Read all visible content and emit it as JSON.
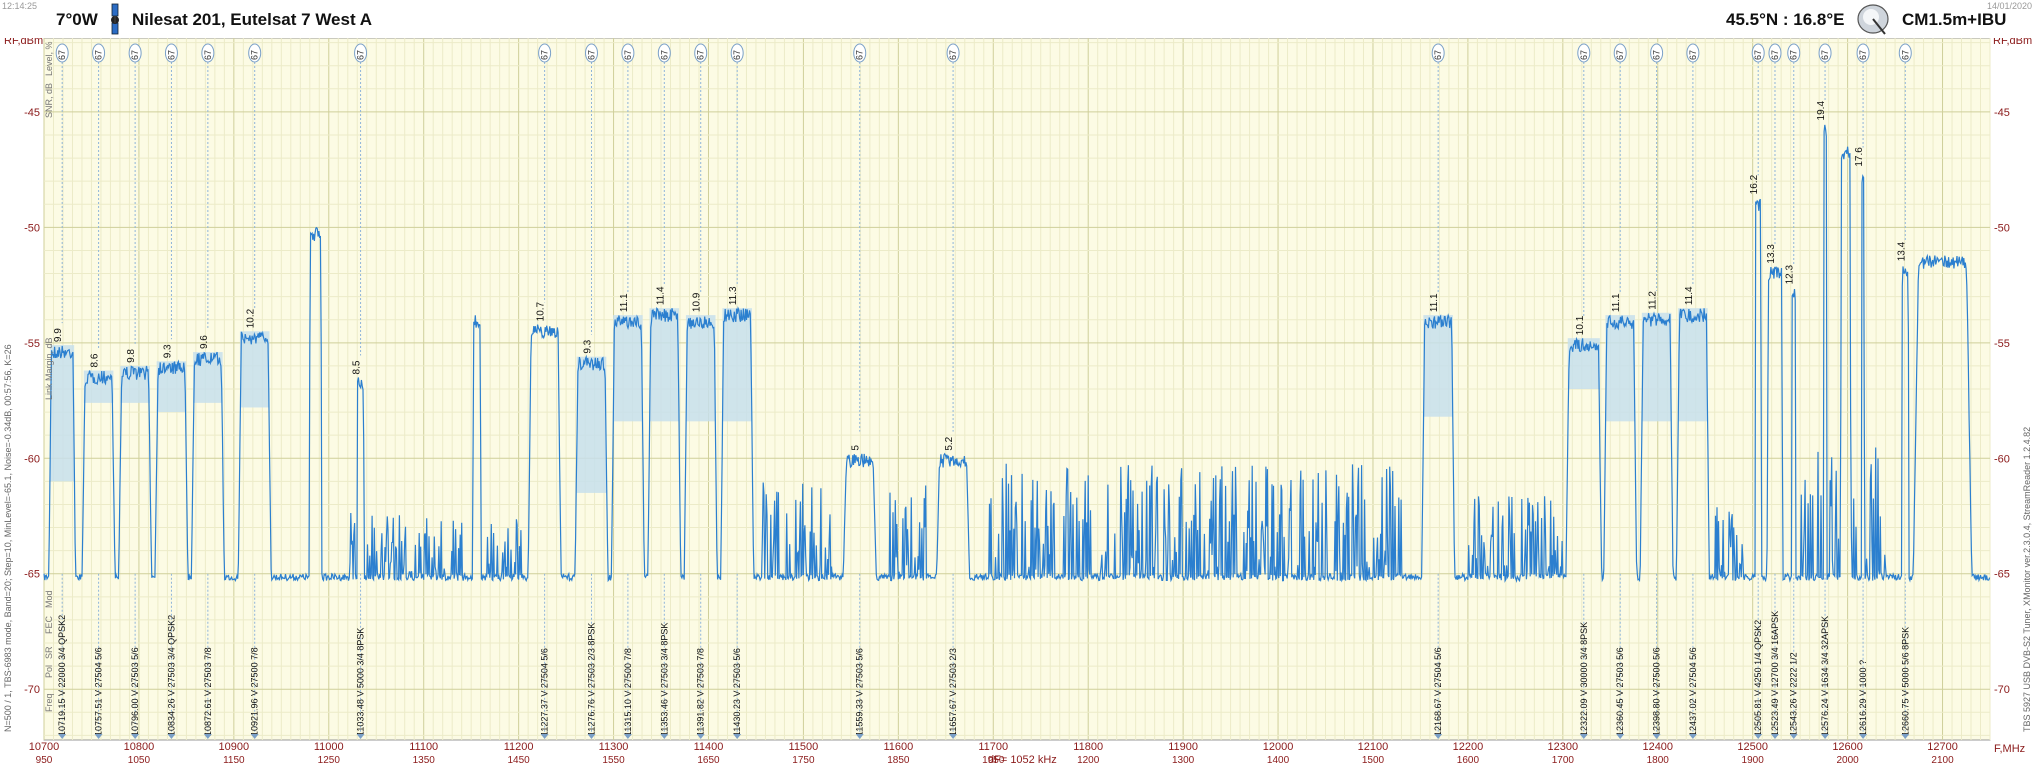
{
  "header": {
    "time": "12:14:25",
    "date": "14/01/2020",
    "orbital_position": "7°0W",
    "satellite_name": "Nilesat 201, Eutelsat 7 West A",
    "location": "45.5°N : 16.8°E",
    "antenna": "CM1.5m+IBU"
  },
  "labels": {
    "left_axis_unit": "RF,dBm",
    "right_axis_unit": "RF,dBm",
    "x_axis_unit": "F,MHz",
    "df_label": "dF= 1052 kHz",
    "left_side_text": "N=500 / 1, TBS-6983 mode, Band=20; Step=10, MinLevel=-65.1, Noise=-0.34dB, 00:57:56, K=26",
    "right_side_text": "TBS 5927 USB DVB-S2 Tuner, XMonitor ver.2.3.0.4, StreamReader 1.2.4.82",
    "vertical_header_top": "Level, %",
    "vertical_header_snr": "SNR, dB",
    "vertical_header_margin": "Link Margin, dB",
    "vertical_header_freq": "Freq",
    "vertical_header_pol": "Pol",
    "vertical_header_sr": "SR",
    "vertical_header_fec": "FEC",
    "vertical_header_mod": "Mod",
    "level_badge": "67"
  },
  "colors": {
    "plot_bg": "#fcfbe4",
    "grid": "#d8d8a8",
    "trace": "#2b7fcf",
    "fill": "#c7dfec",
    "axis_label": "#8b1a1a",
    "text": "#111111"
  },
  "chart_data": {
    "type": "line",
    "title": "",
    "xlabel": "F,MHz",
    "ylabel": "RF,dBm",
    "xlim": [
      10700,
      12750
    ],
    "ylim": [
      -72.2,
      -41.8
    ],
    "x_ticks": [
      10700,
      10800,
      10900,
      11000,
      11100,
      11200,
      11300,
      11400,
      11500,
      11600,
      11700,
      11800,
      11900,
      12000,
      12100,
      12200,
      12300,
      12400,
      12500,
      12600,
      12700
    ],
    "if_ticks": [
      950,
      1050,
      1150,
      1250,
      1350,
      1450,
      1550,
      1650,
      1750,
      1850,
      1950,
      1200,
      1300,
      1400,
      1500,
      1600,
      1700,
      1800,
      1900,
      2000,
      2100
    ],
    "y_ticks": [
      -45,
      -50,
      -55,
      -60,
      -65,
      -70
    ],
    "grid": true,
    "noise_floor": -65,
    "carriers": [
      {
        "freq": "10719.15",
        "pol": "V",
        "sr": "22000",
        "fec": "3/4",
        "mod": "QPSK2",
        "snr": "9.9",
        "f": 10719.15,
        "w": 22.0,
        "level": -55.1,
        "fill_top": -61.0
      },
      {
        "freq": "10757.51",
        "pol": "V",
        "sr": "27504",
        "fec": "5/6",
        "mod": "",
        "snr": "8.6",
        "f": 10757.51,
        "w": 27.5,
        "level": -56.2,
        "fill_top": -57.6
      },
      {
        "freq": "10796.00",
        "pol": "V",
        "sr": "27503",
        "fec": "5/6",
        "mod": "",
        "snr": "9.8",
        "f": 10796.0,
        "w": 27.5,
        "level": -56.0,
        "fill_top": -57.6
      },
      {
        "freq": "10834.26",
        "pol": "V",
        "sr": "27503",
        "fec": "3/4",
        "mod": "QPSK2",
        "snr": "9.3",
        "f": 10834.26,
        "w": 27.5,
        "level": -55.8,
        "fill_top": -58.0
      },
      {
        "freq": "10872.61",
        "pol": "V",
        "sr": "27503",
        "fec": "7/8",
        "mod": "",
        "snr": "9.6",
        "f": 10872.61,
        "w": 27.5,
        "level": -55.4,
        "fill_top": -57.6
      },
      {
        "freq": "10921.96",
        "pol": "V",
        "sr": "27500",
        "fec": "7/8",
        "mod": "",
        "snr": "10.2",
        "f": 10921.96,
        "w": 27.5,
        "level": -54.5,
        "fill_top": -57.8
      },
      {
        "freq": "11033.48",
        "pol": "V",
        "sr": "5000",
        "fec": "3/4",
        "mod": "8PSK",
        "snr": "8.5",
        "f": 11033.48,
        "w": 5.0,
        "level": -56.5,
        "fill_top": -65.0
      },
      {
        "freq": "11227.37",
        "pol": "V",
        "sr": "27504",
        "fec": "5/6",
        "mod": "",
        "snr": "10.7",
        "f": 11227.37,
        "w": 27.5,
        "level": -54.2,
        "fill_top": -65.0
      },
      {
        "freq": "11276.76",
        "pol": "V",
        "sr": "27503",
        "fec": "2/3",
        "mod": "8PSK",
        "snr": "9.3",
        "f": 11276.76,
        "w": 27.5,
        "level": -55.6,
        "fill_top": -61.5
      },
      {
        "freq": "11315.10",
        "pol": "V",
        "sr": "27500",
        "fec": "7/8",
        "mod": "",
        "snr": "11.1",
        "f": 11315.1,
        "w": 27.5,
        "level": -53.8,
        "fill_top": -58.4
      },
      {
        "freq": "11353.46",
        "pol": "V",
        "sr": "27503",
        "fec": "3/4",
        "mod": "8PSK",
        "snr": "11.4",
        "f": 11353.46,
        "w": 27.5,
        "level": -53.5,
        "fill_top": -58.4
      },
      {
        "freq": "11391.82",
        "pol": "V",
        "sr": "27503",
        "fec": "7/8",
        "mod": "",
        "snr": "10.9",
        "f": 11391.82,
        "w": 27.5,
        "level": -53.8,
        "fill_top": -58.4
      },
      {
        "freq": "11430.23",
        "pol": "V",
        "sr": "27503",
        "fec": "5/6",
        "mod": "",
        "snr": "11.3",
        "f": 11430.23,
        "w": 27.5,
        "level": -53.5,
        "fill_top": -58.4
      },
      {
        "freq": "11559.33",
        "pol": "V",
        "sr": "27503",
        "fec": "5/6",
        "mod": "",
        "snr": "5",
        "f": 11559.33,
        "w": 27.5,
        "level": -59.8,
        "fill_top": -65.0
      },
      {
        "freq": "11657.67",
        "pol": "V",
        "sr": "27503",
        "fec": "2/3",
        "mod": "",
        "snr": "5.2",
        "f": 11657.67,
        "w": 27.5,
        "level": -59.8,
        "fill_top": -65.0
      },
      {
        "freq": "12168.67",
        "pol": "V",
        "sr": "27504",
        "fec": "5/6",
        "mod": "",
        "snr": "11.1",
        "f": 12168.67,
        "w": 27.5,
        "level": -53.8,
        "fill_top": -58.2
      },
      {
        "freq": "12322.09",
        "pol": "V",
        "sr": "30000",
        "fec": "3/4",
        "mod": "8PSK",
        "snr": "10.1",
        "f": 12322.09,
        "w": 30.0,
        "level": -54.8,
        "fill_top": -57.0
      },
      {
        "freq": "12360.45",
        "pol": "V",
        "sr": "27503",
        "fec": "5/6",
        "mod": "",
        "snr": "11.1",
        "f": 12360.45,
        "w": 27.5,
        "level": -53.8,
        "fill_top": -58.4
      },
      {
        "freq": "12398.80",
        "pol": "V",
        "sr": "27500",
        "fec": "5/6",
        "mod": "",
        "snr": "11.2",
        "f": 12398.8,
        "w": 27.5,
        "level": -53.7,
        "fill_top": -58.4
      },
      {
        "freq": "12437.02",
        "pol": "V",
        "sr": "27504",
        "fec": "5/6",
        "mod": "",
        "snr": "11.4",
        "f": 12437.02,
        "w": 27.5,
        "level": -53.5,
        "fill_top": -58.4
      },
      {
        "freq": "12505.81",
        "pol": "V",
        "sr": "4250",
        "fec": "1/4",
        "mod": "QPSK2",
        "snr": "16.2",
        "f": 12505.81,
        "w": 4.25,
        "level": -48.7,
        "fill_top": -65.0
      },
      {
        "freq": "12523.49",
        "pol": "V",
        "sr": "12700",
        "fec": "3/4",
        "mod": "16APSK",
        "snr": "13.3",
        "f": 12523.49,
        "w": 12.7,
        "level": -51.7,
        "fill_top": -65.0
      },
      {
        "freq": "12543.26",
        "pol": "V",
        "sr": "2222",
        "fec": "1/2",
        "mod": "",
        "snr": "12.3",
        "f": 12543.26,
        "w": 2.2,
        "level": -52.6,
        "fill_top": -65.0
      },
      {
        "freq": "12576.24",
        "pol": "V",
        "sr": "1634",
        "fec": "3/4",
        "mod": "32APSK",
        "snr": "19.4",
        "f": 12576.24,
        "w": 1.6,
        "level": -45.5,
        "fill_top": -65.0
      },
      {
        "freq": "12616.29",
        "pol": "V",
        "sr": "1000",
        "fec": "?",
        "mod": "",
        "snr": "17.6",
        "f": 12616.29,
        "w": 1.0,
        "level": -47.5,
        "fill_top": -65.0
      },
      {
        "freq": "12660.75",
        "pol": "V",
        "sr": "5000",
        "fec": "5/6",
        "mod": "8PSK",
        "snr": "13.4",
        "f": 12660.75,
        "w": 5.0,
        "level": -51.6,
        "fill_top": -65.0
      }
    ],
    "extra_signals": [
      {
        "f": 10986,
        "w": 10,
        "level": -50.0
      },
      {
        "f": 11156,
        "w": 6,
        "level": -53.8
      },
      {
        "f": 12598,
        "w": 8,
        "level": -46.5
      },
      {
        "f": 12700,
        "w": 50,
        "level": -51.2
      }
    ],
    "noise_regions": [
      {
        "from": 11020,
        "to": 11140,
        "amp": 2.2
      },
      {
        "from": 11165,
        "to": 11205,
        "amp": 2.0
      },
      {
        "from": 11455,
        "to": 11530,
        "amp": 3.5
      },
      {
        "from": 11590,
        "to": 11630,
        "amp": 3.2
      },
      {
        "from": 11690,
        "to": 12130,
        "amp": 4.0
      },
      {
        "from": 12200,
        "to": 12300,
        "amp": 2.8
      },
      {
        "from": 12460,
        "to": 12490,
        "amp": 2.4
      },
      {
        "from": 12550,
        "to": 12640,
        "amp": 5.0
      }
    ]
  }
}
